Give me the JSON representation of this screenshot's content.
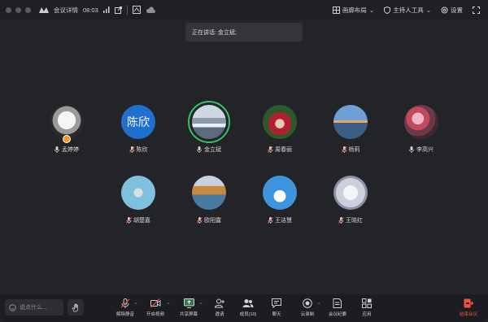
{
  "titlebar": {
    "app_label": "会议详情",
    "duration": "08:03",
    "layout_label": "画廊布局",
    "host_tools_label": "主持人工具",
    "settings_label": "设置"
  },
  "toast": {
    "text": "正在讲话: 金立斌;"
  },
  "participants": [
    {
      "name": "孟婷婷",
      "mic": "on"
    },
    {
      "name": "陈欣",
      "mic": "off",
      "avatar_text": "陈欣"
    },
    {
      "name": "金立斌",
      "mic": "on"
    },
    {
      "name": "周春丽",
      "mic": "off"
    },
    {
      "name": "杨莉",
      "mic": "off"
    },
    {
      "name": "李高兴",
      "mic": "on"
    },
    {
      "name": "胡楚嘉",
      "mic": "off"
    },
    {
      "name": "欧阳露",
      "mic": "off"
    },
    {
      "name": "王洁慧",
      "mic": "off"
    },
    {
      "name": "王晓红",
      "mic": "off"
    }
  ],
  "bottombar": {
    "chat_placeholder": "说点什么...",
    "tools": {
      "mute": "解除静音",
      "video": "开启视频",
      "share": "共享屏幕",
      "invite": "邀请",
      "members": "成员(10)",
      "chat": "聊天",
      "record": "云录制",
      "minutes": "会议纪要",
      "apps": "应用",
      "leave": "结束会议"
    }
  },
  "colors": {
    "background": "#232428",
    "speaking_ring": "#36c26b",
    "mic_off": "#e5534b",
    "leave": "#f0523d",
    "text_avatar": "#1f6fd1"
  }
}
